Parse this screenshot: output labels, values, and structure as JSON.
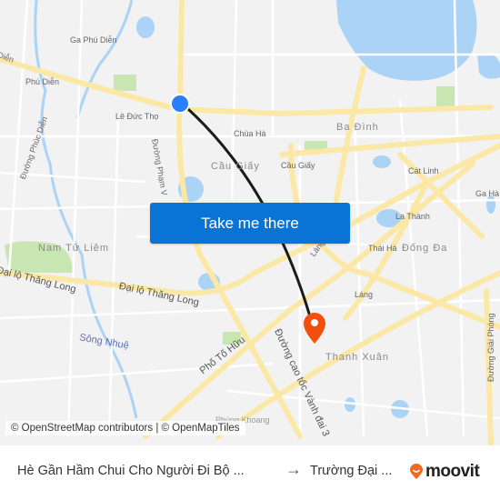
{
  "map": {
    "labels": {
      "ga_phu_dien": "Ga Phú Diễn",
      "phu_dien": "Phú Diễn",
      "dien_road": "Diễn",
      "le_duc_tho": "Lê Đức Thọ",
      "duong_phuc_dien": "Đường Phúc Diễn",
      "duong_pham": "Đường Phạm V",
      "chua_ha": "Chùa Hà",
      "cau_giay_district": "Cầu Giấy",
      "cau_giay": "Cầu Giấy",
      "ba_dinh": "Ba Đình",
      "cat_linh": "Cát Linh",
      "ga_ha": "Ga Hà",
      "la_thanh": "La Thành",
      "thai_ha": "Thái Hà",
      "dong_da": "Đống Đa",
      "lang_road": "Láng",
      "lang": "Láng",
      "nam_tu_liem": "Nam Từ Liêm",
      "dai_lo_thang_long_left": "Đại lộ Thăng Long",
      "dai_lo_thang_long": "Đại lộ Thăng Long",
      "song_nhue": "Sông Nhuệ",
      "pho_to_huu": "Phố Tố Hữu",
      "duong_cao_toc": "Đường cao tốc Vành đai 3",
      "thanh_xuan": "Thanh Xuân",
      "phung_khoang": "Phùng Khoang",
      "duong_giai_phong": "Đường Giải Phóng"
    },
    "origin_marker": {
      "icon": "origin-dot-icon",
      "color": "#2a7fff"
    },
    "destination_marker": {
      "icon": "map-pin-icon",
      "color": "#f24e0c"
    },
    "route_color": "#1a1a1a"
  },
  "cta": {
    "label": "Take me there",
    "color": "#0a73d6"
  },
  "attribution": "© OpenStreetMap contributors | © OpenMapTiles",
  "footer": {
    "from": "Hè Gần Hầm Chui Cho Người Đi Bộ ...",
    "arrow": "→",
    "to": "Trường Đại ...",
    "brand": "moovit",
    "brand_color": "#f26a21"
  }
}
